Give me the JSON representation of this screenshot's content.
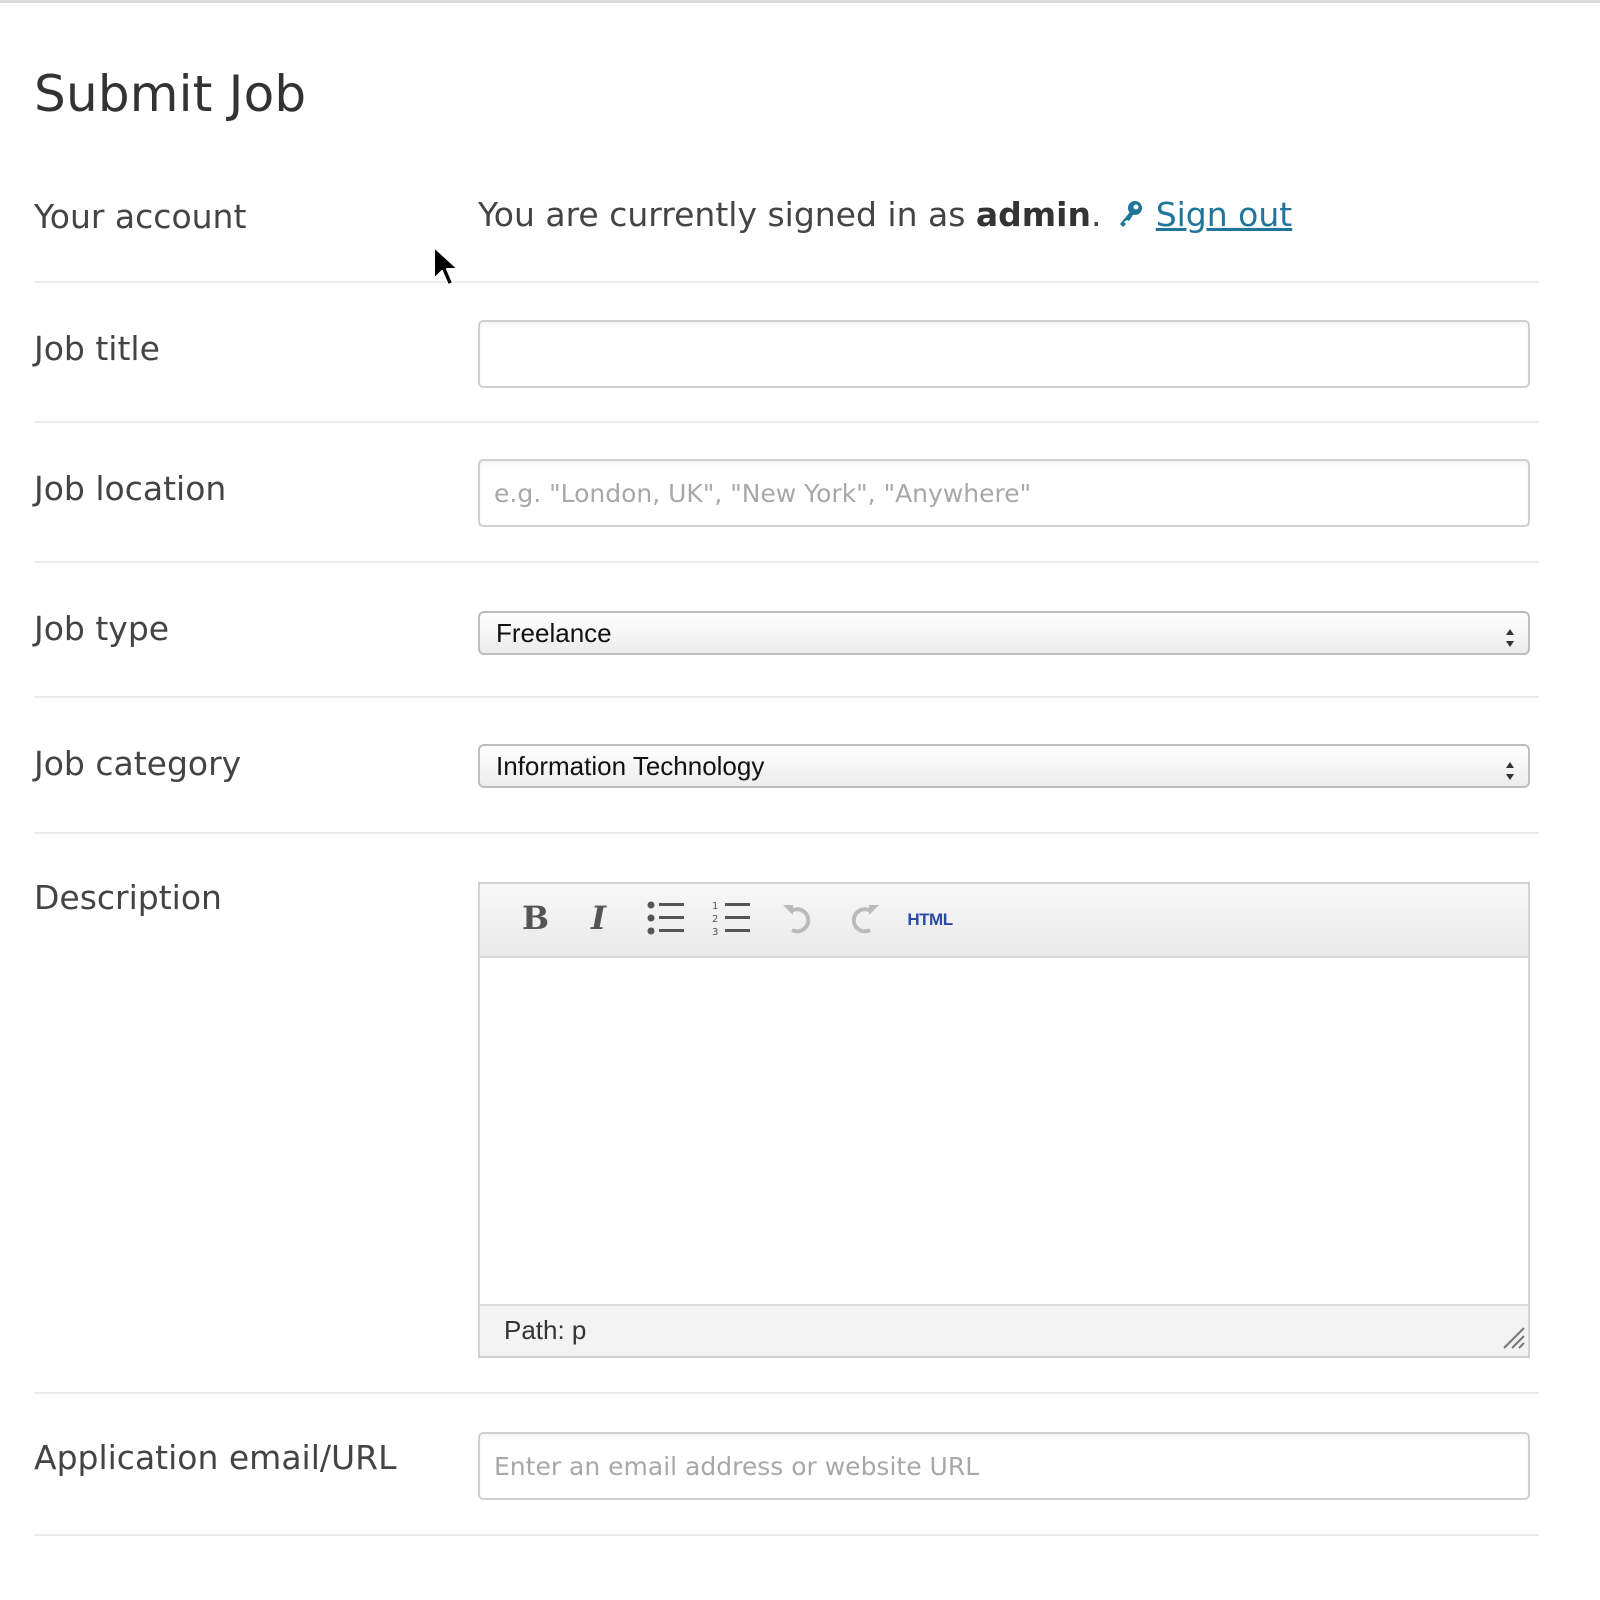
{
  "page": {
    "title": "Submit Job"
  },
  "account": {
    "label": "Your account",
    "signed_in_prefix": "You are currently signed in as ",
    "username": "admin",
    "signed_in_suffix": ".",
    "signout_label": "Sign out",
    "link_color": "#21759b"
  },
  "job_title": {
    "label": "Job title",
    "value": "",
    "placeholder": ""
  },
  "job_location": {
    "label": "Job location",
    "value": "",
    "placeholder": "e.g. \"London, UK\", \"New York\", \"Anywhere\""
  },
  "job_type": {
    "label": "Job type",
    "selected": "Freelance"
  },
  "job_category": {
    "label": "Job category",
    "selected": "Information Technology"
  },
  "description": {
    "label": "Description",
    "toolbar": {
      "bold_icon": "bold-icon",
      "italic_icon": "italic-icon",
      "bullet_list_icon": "bullet-list-icon",
      "numbered_list_icon": "numbered-list-icon",
      "undo_icon": "undo-icon",
      "redo_icon": "redo-icon",
      "html_label": "HTML"
    },
    "status_path": "Path: p"
  },
  "application": {
    "label": "Application email/URL",
    "value": "",
    "placeholder": "Enter an email address or website URL"
  }
}
